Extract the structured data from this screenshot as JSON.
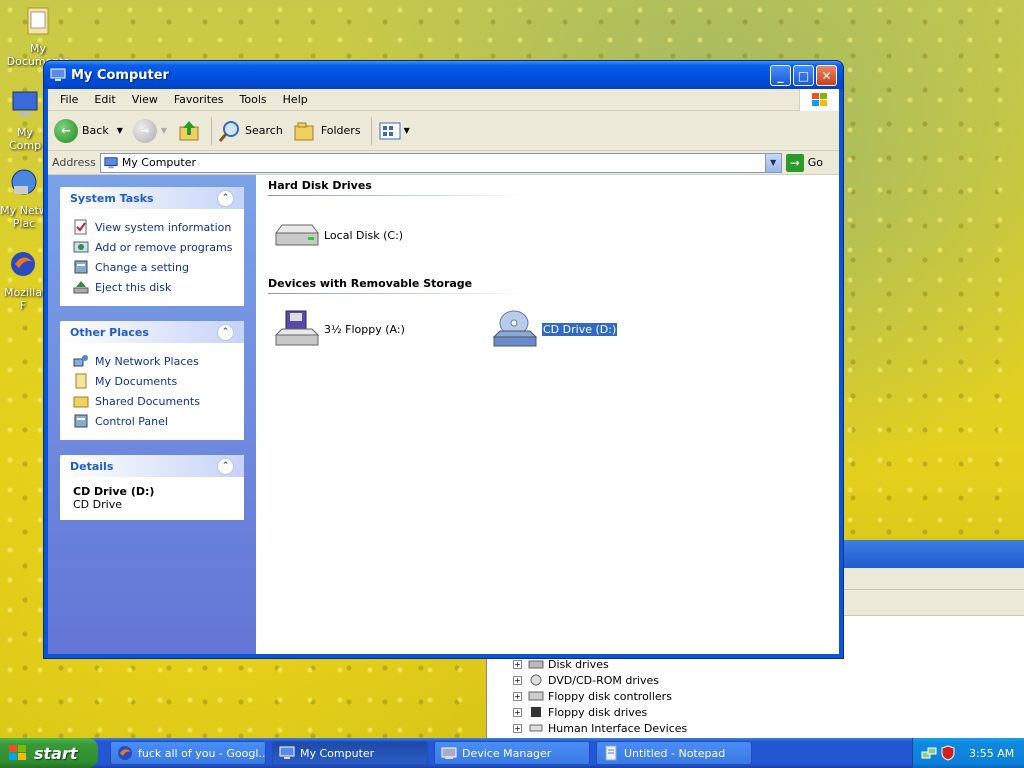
{
  "desktop": {
    "icons": [
      {
        "label": "My Documents"
      },
      {
        "label": "My Comp"
      },
      {
        "label": "My Netw Plac"
      },
      {
        "label": "Mozilla F"
      }
    ]
  },
  "window": {
    "title": "My Computer",
    "menu": [
      "File",
      "Edit",
      "View",
      "Favorites",
      "Tools",
      "Help"
    ],
    "toolbar": {
      "back": "Back",
      "search": "Search",
      "folders": "Folders"
    },
    "address": {
      "label": "Address",
      "value": "My Computer",
      "go": "Go"
    },
    "system_tasks": {
      "title": "System Tasks",
      "items": [
        "View system information",
        "Add or remove programs",
        "Change a setting",
        "Eject this disk"
      ]
    },
    "other_places": {
      "title": "Other Places",
      "items": [
        "My Network Places",
        "My Documents",
        "Shared Documents",
        "Control Panel"
      ]
    },
    "details": {
      "title": "Details",
      "name": "CD Drive (D:)",
      "type": "CD Drive"
    },
    "groups": {
      "hard": {
        "title": "Hard Disk Drives",
        "items": [
          "Local Disk (C:)"
        ]
      },
      "removable": {
        "title": "Devices with Removable Storage",
        "items": [
          "3½ Floppy (A:)",
          "CD Drive (D:)"
        ]
      }
    },
    "selected_item": "CD Drive (D:)"
  },
  "device_manager_bg": {
    "tree": [
      "Disk drives",
      "DVD/CD-ROM drives",
      "Floppy disk controllers",
      "Floppy disk drives",
      "Human Interface Devices"
    ]
  },
  "taskbar": {
    "start": "start",
    "buttons": [
      "fuck all of you - Googl...",
      "My Computer",
      "Device Manager",
      "Untitled - Notepad"
    ],
    "active_button": "My Computer",
    "clock": "3:55 AM"
  },
  "colors": {
    "title_blue": "#0052e0",
    "taskbar_blue": "#2557d4",
    "start_green": "#2f8f2f",
    "selection": "#316ac5"
  }
}
